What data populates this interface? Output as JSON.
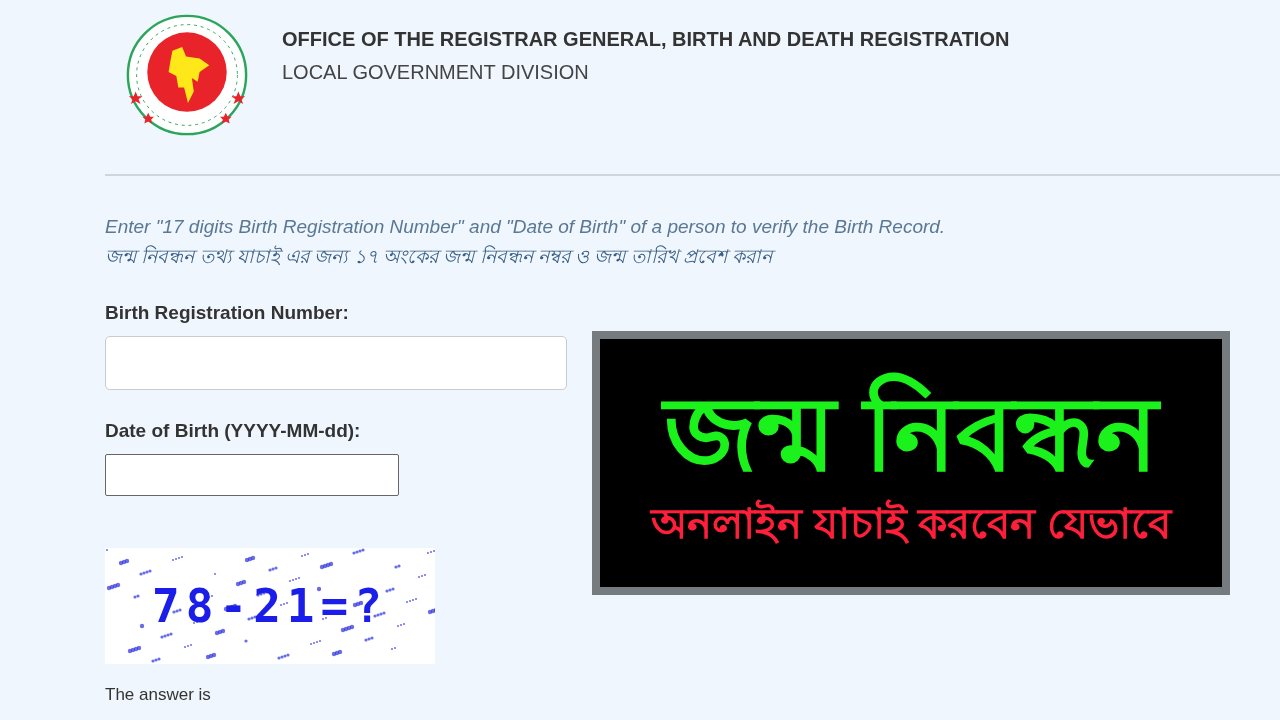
{
  "header": {
    "title": "OFFICE OF THE REGISTRAR GENERAL, BIRTH AND DEATH REGISTRATION",
    "subtitle": "LOCAL GOVERNMENT DIVISION"
  },
  "instructions": {
    "english": "Enter \"17 digits Birth Registration Number\" and \"Date of Birth\" of a person to verify the Birth Record.",
    "bangla": "জন্ম নিবন্ধন তথ্য যাচাই এর জন্য ১৭ অংকের জন্ম নিবন্ধন নম্বর ও জন্ম তারিখ প্রবেশ করান"
  },
  "form": {
    "fields": [
      {
        "label": "Birth Registration Number:",
        "kind": "wide"
      },
      {
        "label": "Date of Birth (YYYY-MM-dd):",
        "kind": "narrow"
      }
    ],
    "captcha": {
      "text": "78-21=?"
    },
    "answer_label": "The answer is"
  },
  "banner": {
    "title": "জন্ম নিবন্ধন",
    "subtitle": "অনলাইন যাচাই করবেন যেভাবে"
  }
}
